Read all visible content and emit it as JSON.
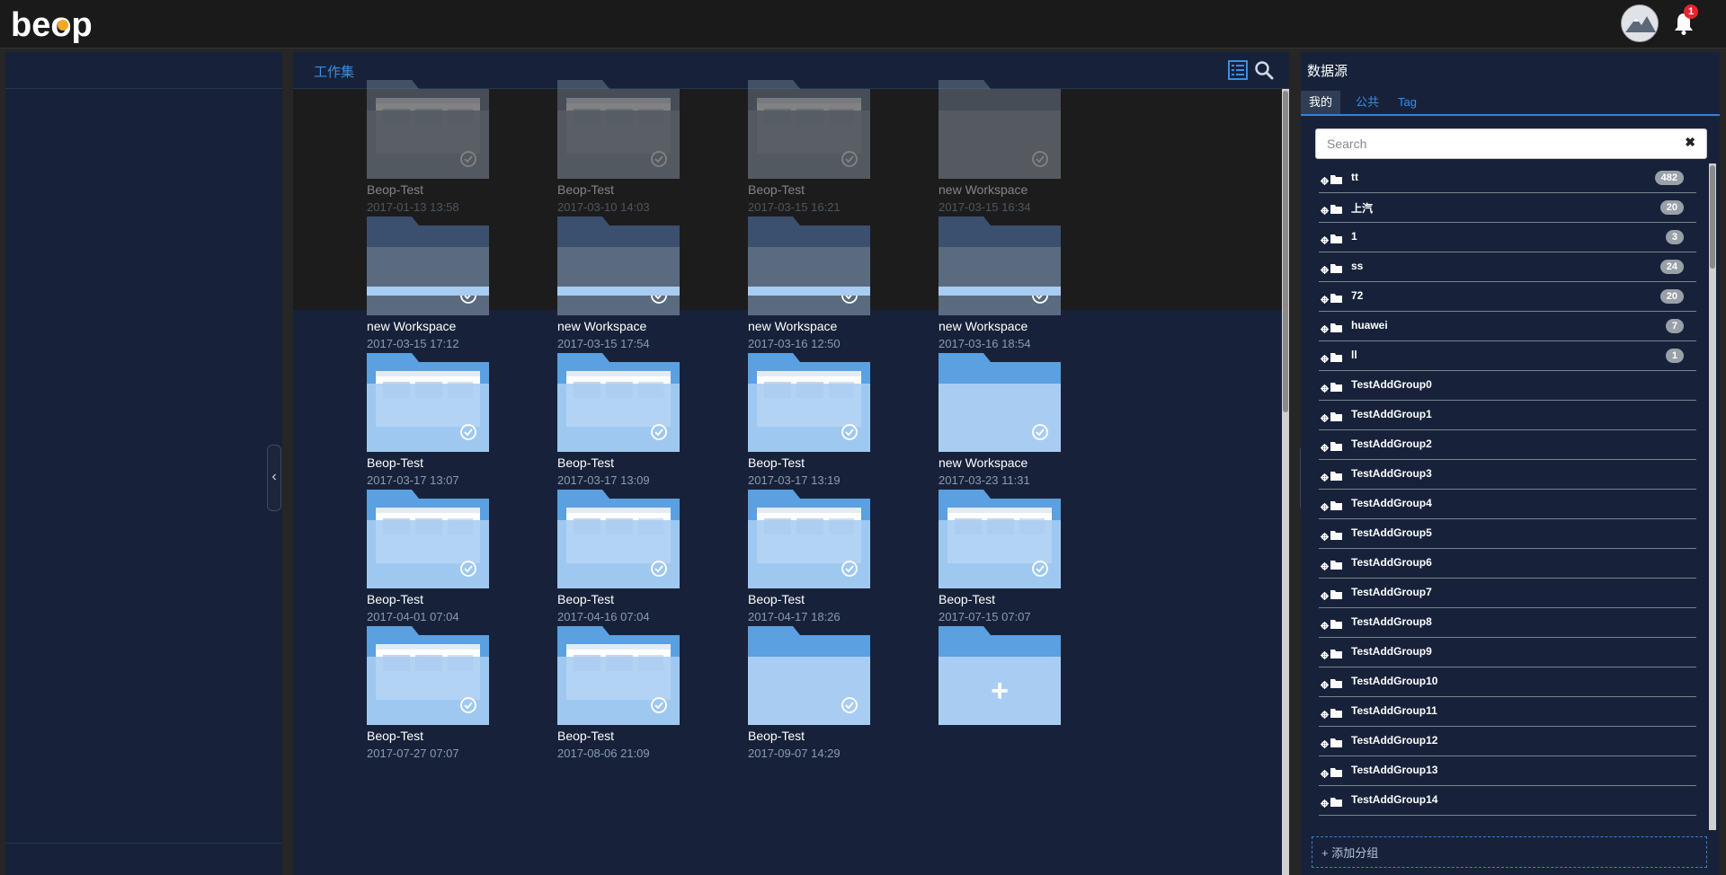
{
  "app": {
    "logo_text": "beop"
  },
  "header": {
    "notification_count": "1"
  },
  "workspaces_panel": {
    "title": "工作集",
    "items": [
      {
        "name": "Beop-Test",
        "date": "2017-01-13 13:58",
        "thumb": true,
        "state": "faded"
      },
      {
        "name": "Beop-Test",
        "date": "2017-03-10 14:03",
        "thumb": true,
        "state": "faded"
      },
      {
        "name": "Beop-Test",
        "date": "2017-03-15 16:21",
        "thumb": true,
        "state": "faded"
      },
      {
        "name": "new Workspace",
        "date": "2017-03-15 16:34",
        "thumb": false,
        "state": "faded"
      },
      {
        "name": "new Workspace",
        "date": "2017-03-15 17:12",
        "thumb": false,
        "state": "dark"
      },
      {
        "name": "new Workspace",
        "date": "2017-03-15 17:54",
        "thumb": false,
        "state": "dark"
      },
      {
        "name": "new Workspace",
        "date": "2017-03-16 12:50",
        "thumb": false,
        "state": "dark"
      },
      {
        "name": "new Workspace",
        "date": "2017-03-16 18:54",
        "thumb": false,
        "state": "dark"
      },
      {
        "name": "Beop-Test",
        "date": "2017-03-17 13:07",
        "thumb": true,
        "state": "normal"
      },
      {
        "name": "Beop-Test",
        "date": "2017-03-17 13:09",
        "thumb": true,
        "state": "normal"
      },
      {
        "name": "Beop-Test",
        "date": "2017-03-17 13:19",
        "thumb": true,
        "state": "normal"
      },
      {
        "name": "new Workspace",
        "date": "2017-03-23 11:31",
        "thumb": false,
        "state": "normal"
      },
      {
        "name": "Beop-Test",
        "date": "2017-04-01 07:04",
        "thumb": true,
        "state": "normal"
      },
      {
        "name": "Beop-Test",
        "date": "2017-04-16 07:04",
        "thumb": true,
        "state": "normal"
      },
      {
        "name": "Beop-Test",
        "date": "2017-04-17 18:26",
        "thumb": true,
        "state": "normal"
      },
      {
        "name": "Beop-Test",
        "date": "2017-07-15 07:07",
        "thumb": true,
        "state": "normal"
      },
      {
        "name": "Beop-Test",
        "date": "2017-07-27 07:07",
        "thumb": true,
        "state": "normal"
      },
      {
        "name": "Beop-Test",
        "date": "2017-08-06 21:09",
        "thumb": true,
        "state": "normal"
      },
      {
        "name": "Beop-Test",
        "date": "2017-09-07 14:29",
        "thumb": false,
        "state": "normal"
      }
    ],
    "add_symbol": "+"
  },
  "datasource_panel": {
    "title": "数据源",
    "tabs": [
      "我的",
      "公共",
      "Tag"
    ],
    "active_tab": 0,
    "search_placeholder": "Search",
    "clear_symbol": "✖",
    "groups": [
      {
        "name": "tt",
        "count": "482"
      },
      {
        "name": "上汽",
        "count": "20"
      },
      {
        "name": "1",
        "count": "3"
      },
      {
        "name": "ss",
        "count": "24"
      },
      {
        "name": "72",
        "count": "20"
      },
      {
        "name": "huawei",
        "count": "7"
      },
      {
        "name": "ll",
        "count": "1"
      },
      {
        "name": "TestAddGroup0",
        "count": ""
      },
      {
        "name": "TestAddGroup1",
        "count": ""
      },
      {
        "name": "TestAddGroup2",
        "count": ""
      },
      {
        "name": "TestAddGroup3",
        "count": ""
      },
      {
        "name": "TestAddGroup4",
        "count": ""
      },
      {
        "name": "TestAddGroup5",
        "count": ""
      },
      {
        "name": "TestAddGroup6",
        "count": ""
      },
      {
        "name": "TestAddGroup7",
        "count": ""
      },
      {
        "name": "TestAddGroup8",
        "count": ""
      },
      {
        "name": "TestAddGroup9",
        "count": ""
      },
      {
        "name": "TestAddGroup10",
        "count": ""
      },
      {
        "name": "TestAddGroup11",
        "count": ""
      },
      {
        "name": "TestAddGroup12",
        "count": ""
      },
      {
        "name": "TestAddGroup13",
        "count": ""
      },
      {
        "name": "TestAddGroup14",
        "count": ""
      }
    ],
    "add_group_label": "+ 添加分组"
  },
  "toggles": {
    "left": "‹",
    "right": "›"
  },
  "colors": {
    "accent": "#3a8ee6",
    "panel_bg": "#17223a",
    "folder_light": "#a9cdf2",
    "folder_dark": "#5ba0e0",
    "badge_red": "#e8232e"
  }
}
